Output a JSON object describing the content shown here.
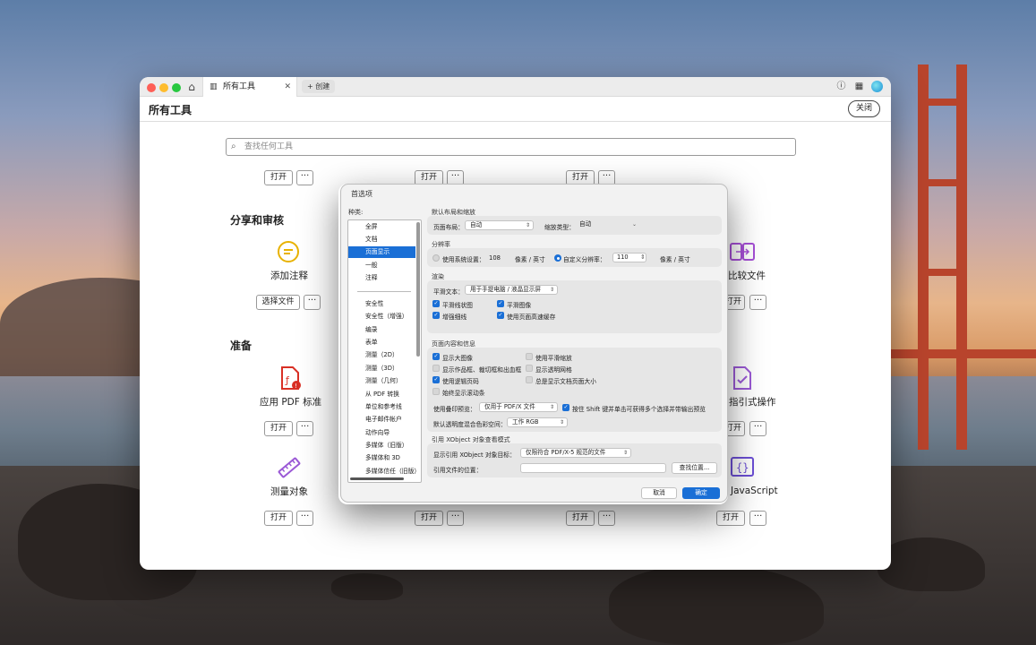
{
  "window": {
    "tab_title": "所有工具",
    "new_tab_label": "+ 创建",
    "page_title": "所有工具",
    "close_label": "关闭",
    "search_placeholder": "查找任何工具"
  },
  "tools": {
    "open_label": "打开",
    "more_label": "···",
    "choose_file_label": "选择文件",
    "section_share": "分享和审核",
    "section_prepare": "准备",
    "add_comment": "添加注释",
    "compare_files": "比较文件",
    "apply_pdf_standard": "应用 PDF 标准",
    "guided_action": "指引式操作",
    "measure_object": "测量对象",
    "javascript": "JavaScript"
  },
  "prefs": {
    "title": "首选项",
    "categories_label": "种类:",
    "categories": [
      "全屏",
      "文档",
      "页面显示",
      "一般",
      "注释",
      "安全性",
      "安全性（增强）",
      "编录",
      "表单",
      "测量（2D）",
      "测量（3D）",
      "测量（几何）",
      "从 PDF 转换",
      "单位和参考线",
      "电子邮件帐户",
      "动作向导",
      "多媒体（旧版）",
      "多媒体和 3D",
      "多媒体信任（旧版）"
    ],
    "selected_category": "页面显示",
    "layout_group": "默认布局和缩放",
    "page_layout_label": "页面布局：",
    "page_layout_value": "自动",
    "zoom_label": "缩放类型：",
    "zoom_value": "自动",
    "resolution_group": "分辨率",
    "use_system_label": "使用系统设置：",
    "system_res_value": "108",
    "pixels_per_inch": "像素 / 英寸",
    "custom_res_label": "自定义分辨率：",
    "custom_res_value": "110",
    "rendering_group": "渲染",
    "smooth_text_label": "平滑文本：",
    "smooth_text_value": "用于手提电脑 / 液晶显示屏",
    "smooth_line_art": "平滑线状图",
    "smooth_images": "平滑图像",
    "enhance_thin_lines": "增强细线",
    "use_page_cache": "使用页面高速缓存",
    "content_group": "页面内容和信息",
    "show_large_images": "显示大图像",
    "smooth_zoom": "使用平滑缩放",
    "show_art_trim_bleed": "显示作品框、裁切框和出血框",
    "show_transparency_grid": "显示透明网格",
    "use_logical_page_numbers": "使用逻辑页码",
    "always_show_doc_page_size": "总是显示文档页面大小",
    "always_show_scrollbars": "始终显示滚动条",
    "overprint_label": "使用叠印预览：",
    "overprint_value": "仅用于 PDF/X 文件",
    "shift_hint": "按住 Shift 键并单击可获得多个选择并带输出预览",
    "blend_label": "默认透明度混合色彩空间：",
    "blend_value": "工作 RGB",
    "xobject_group": "引用 XObject 对象查看模式",
    "xobject_show_label": "显示引用 XObject 对象目标：",
    "xobject_show_value": "仅限符合 PDF/X-5 规范的文件",
    "ref_location_label": "引用文件的位置：",
    "browse_label": "查找位置...",
    "cancel_label": "取消",
    "ok_label": "确定"
  },
  "colors": {
    "accent": "#1a6fd6",
    "comment_icon": "#e8b200",
    "compare_icon": "#a64fd6",
    "pdf_std_icon": "#d93025",
    "measure_icon": "#9b59d6"
  }
}
